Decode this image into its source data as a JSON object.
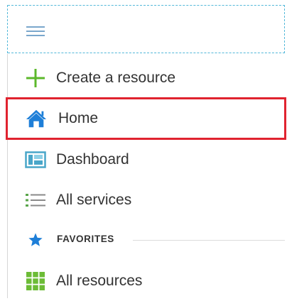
{
  "menu": {
    "hamburger_icon": "hamburger-menu-icon"
  },
  "items": [
    {
      "label": "Create a resource",
      "icon": "plus-icon",
      "icon_color": "#5cb82b"
    },
    {
      "label": "Home",
      "icon": "home-icon",
      "icon_color": "#1e7fd8",
      "highlighted": true,
      "highlight_color": "#e0232f"
    },
    {
      "label": "Dashboard",
      "icon": "dashboard-icon",
      "icon_color": "#49a6c9"
    },
    {
      "label": "All services",
      "icon": "list-icon",
      "icon_color": "#59a54a"
    }
  ],
  "favorites": {
    "label": "FAVORITES",
    "icon": "star-icon",
    "icon_color": "#1e7fd8",
    "items": [
      {
        "label": "All resources",
        "icon": "grid-icon",
        "icon_color": "#6cbc36"
      }
    ]
  }
}
